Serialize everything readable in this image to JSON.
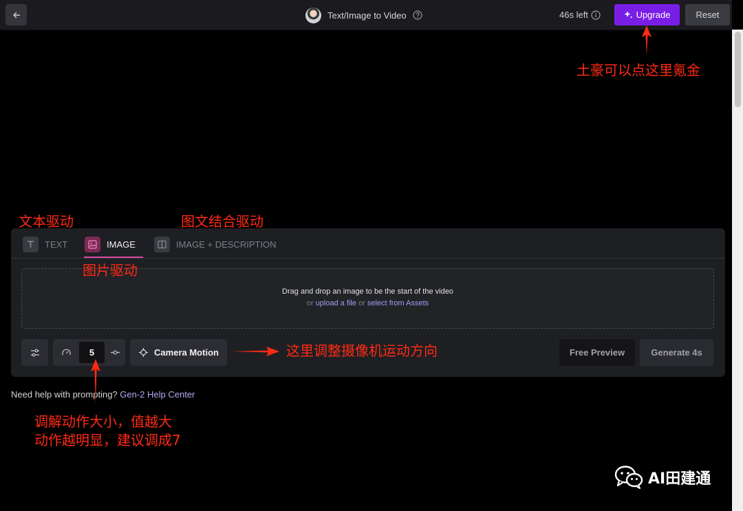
{
  "header": {
    "title": "Text/Image to Video",
    "time_left": "46s left",
    "upgrade_label": "Upgrade",
    "reset_label": "Reset"
  },
  "tabs": [
    {
      "label": "TEXT",
      "icon": "text-icon"
    },
    {
      "label": "IMAGE",
      "icon": "image-icon",
      "active": true
    },
    {
      "label": "IMAGE + DESCRIPTION",
      "icon": "image-description-icon"
    }
  ],
  "dropzone": {
    "main": "Drag and drop an image to be the start of the video",
    "or1": "or",
    "upload_link": "upload a file",
    "or2": "or",
    "assets_link": "select from Assets"
  },
  "controls": {
    "speed_value": "5",
    "camera_motion_label": "Camera Motion",
    "free_preview_label": "Free Preview",
    "generate_label": "Generate 4s"
  },
  "help": {
    "text": "Need help with prompting?",
    "link": "Gen-2 Help Center"
  },
  "annotations": {
    "upgrade_note": "土豪可以点这里氪金",
    "text_drive": "文本驱动",
    "image_text_drive": "图文结合驱动",
    "image_drive": "图片驱动",
    "camera_note": "这里调整摄像机运动方向",
    "motion_note_line1": "调解动作大小，值越大",
    "motion_note_line2": "动作越明显，建议调成7"
  },
  "watermark": {
    "text": "AI田建通"
  },
  "colors": {
    "accent_purple": "#7a1ee6",
    "active_tab": "#d64aa0",
    "link": "#a89cf5",
    "annotation_red": "#ff2a14"
  }
}
